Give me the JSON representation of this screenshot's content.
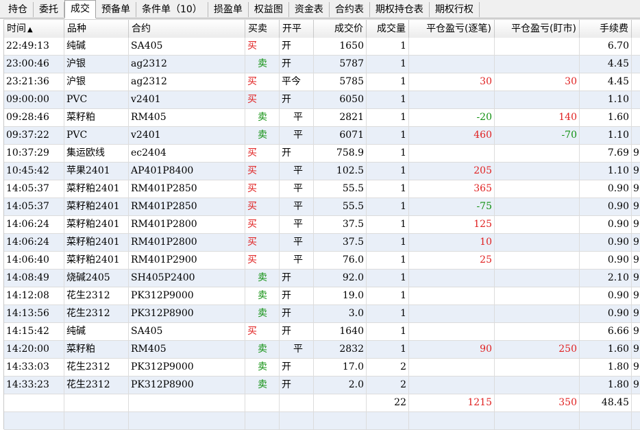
{
  "tabs": [
    {
      "label": "持仓",
      "active": false
    },
    {
      "label": "委托",
      "active": false
    },
    {
      "label": "成交",
      "active": true
    },
    {
      "label": "预备单",
      "active": false
    },
    {
      "label": "条件单（10）",
      "active": false
    },
    {
      "label": "损盈单",
      "active": false
    },
    {
      "label": "权益图",
      "active": false
    },
    {
      "label": "资金表",
      "active": false
    },
    {
      "label": "合约表",
      "active": false
    },
    {
      "label": "期权持仓表",
      "active": false
    },
    {
      "label": "期权行权",
      "active": false
    }
  ],
  "columns": {
    "time": "时间",
    "sort_indicator": "▲",
    "product": "品种",
    "contract": "合约",
    "direction": "买卖",
    "open_close": "开平",
    "price": "成交价",
    "volume": "成交量",
    "pnl_trade": "平仓盈亏(逐笔)",
    "pnl_mark": "平仓盈亏(盯市)",
    "fee": "手续费"
  },
  "rows": [
    {
      "time": "22:49:13",
      "product": "纯碱",
      "contract": "SA405",
      "direction": "买",
      "open_close": "开",
      "price": "1650",
      "volume": "1",
      "pnl_trade": "",
      "pnl_mark": "",
      "fee": "6.70",
      "extra": ""
    },
    {
      "time": "23:00:46",
      "product": "沪银",
      "contract": "ag2312",
      "direction": "卖",
      "open_close": "开",
      "price": "5787",
      "volume": "1",
      "pnl_trade": "",
      "pnl_mark": "",
      "fee": "4.45",
      "extra": ""
    },
    {
      "time": "23:21:36",
      "product": "沪银",
      "contract": "ag2312",
      "direction": "买",
      "open_close": "平今",
      "price": "5785",
      "volume": "1",
      "pnl_trade": "30",
      "pnl_mark": "30",
      "fee": "4.45",
      "extra": ""
    },
    {
      "time": "09:00:00",
      "product": "PVC",
      "contract": "v2401",
      "direction": "买",
      "open_close": "开",
      "price": "6050",
      "volume": "1",
      "pnl_trade": "",
      "pnl_mark": "",
      "fee": "1.10",
      "extra": ""
    },
    {
      "time": "09:28:46",
      "product": "菜籽粕",
      "contract": "RM405",
      "direction": "卖",
      "open_close": "平",
      "price": "2821",
      "volume": "1",
      "pnl_trade": "-20",
      "pnl_mark": "140",
      "fee": "1.60",
      "extra": ""
    },
    {
      "time": "09:37:22",
      "product": "PVC",
      "contract": "v2401",
      "direction": "卖",
      "open_close": "平",
      "price": "6071",
      "volume": "1",
      "pnl_trade": "460",
      "pnl_mark": "-70",
      "fee": "1.10",
      "extra": ""
    },
    {
      "time": "10:37:29",
      "product": "集运欧线",
      "contract": "ec2404",
      "direction": "买",
      "open_close": "开",
      "price": "758.9",
      "volume": "1",
      "pnl_trade": "",
      "pnl_mark": "",
      "fee": "7.69",
      "extra": "9"
    },
    {
      "time": "10:45:42",
      "product": "苹果2401",
      "contract": "AP401P8400",
      "direction": "买",
      "open_close": "平",
      "price": "102.5",
      "volume": "1",
      "pnl_trade": "205",
      "pnl_mark": "",
      "fee": "1.10",
      "extra": "9"
    },
    {
      "time": "14:05:37",
      "product": "菜籽粕2401",
      "contract": "RM401P2850",
      "direction": "买",
      "open_close": "平",
      "price": "55.5",
      "volume": "1",
      "pnl_trade": "365",
      "pnl_mark": "",
      "fee": "0.90",
      "extra": "9"
    },
    {
      "time": "14:05:37",
      "product": "菜籽粕2401",
      "contract": "RM401P2850",
      "direction": "买",
      "open_close": "平",
      "price": "55.5",
      "volume": "1",
      "pnl_trade": "-75",
      "pnl_mark": "",
      "fee": "0.90",
      "extra": "9"
    },
    {
      "time": "14:06:24",
      "product": "菜籽粕2401",
      "contract": "RM401P2800",
      "direction": "买",
      "open_close": "平",
      "price": "37.5",
      "volume": "1",
      "pnl_trade": "125",
      "pnl_mark": "",
      "fee": "0.90",
      "extra": "9"
    },
    {
      "time": "14:06:24",
      "product": "菜籽粕2401",
      "contract": "RM401P2800",
      "direction": "买",
      "open_close": "平",
      "price": "37.5",
      "volume": "1",
      "pnl_trade": "10",
      "pnl_mark": "",
      "fee": "0.90",
      "extra": "9"
    },
    {
      "time": "14:06:40",
      "product": "菜籽粕2401",
      "contract": "RM401P2900",
      "direction": "买",
      "open_close": "平",
      "price": "76.0",
      "volume": "1",
      "pnl_trade": "25",
      "pnl_mark": "",
      "fee": "0.90",
      "extra": "9"
    },
    {
      "time": "14:08:49",
      "product": "烧碱2405",
      "contract": "SH405P2400",
      "direction": "卖",
      "open_close": "开",
      "price": "92.0",
      "volume": "1",
      "pnl_trade": "",
      "pnl_mark": "",
      "fee": "2.10",
      "extra": "9"
    },
    {
      "time": "14:12:08",
      "product": "花生2312",
      "contract": "PK312P9000",
      "direction": "卖",
      "open_close": "开",
      "price": "19.0",
      "volume": "1",
      "pnl_trade": "",
      "pnl_mark": "",
      "fee": "0.90",
      "extra": "9"
    },
    {
      "time": "14:13:56",
      "product": "花生2312",
      "contract": "PK312P8900",
      "direction": "卖",
      "open_close": "开",
      "price": "3.0",
      "volume": "1",
      "pnl_trade": "",
      "pnl_mark": "",
      "fee": "0.90",
      "extra": "9"
    },
    {
      "time": "14:15:42",
      "product": "纯碱",
      "contract": "SA405",
      "direction": "买",
      "open_close": "开",
      "price": "1640",
      "volume": "1",
      "pnl_trade": "",
      "pnl_mark": "",
      "fee": "6.66",
      "extra": "9"
    },
    {
      "time": "14:20:00",
      "product": "菜籽粕",
      "contract": "RM405",
      "direction": "卖",
      "open_close": "平",
      "price": "2832",
      "volume": "1",
      "pnl_trade": "90",
      "pnl_mark": "250",
      "fee": "1.60",
      "extra": "9"
    },
    {
      "time": "14:33:03",
      "product": "花生2312",
      "contract": "PK312P9000",
      "direction": "卖",
      "open_close": "开",
      "price": "17.0",
      "volume": "2",
      "pnl_trade": "",
      "pnl_mark": "",
      "fee": "1.80",
      "extra": "9"
    },
    {
      "time": "14:33:23",
      "product": "花生2312",
      "contract": "PK312P8900",
      "direction": "卖",
      "open_close": "开",
      "price": "2.0",
      "volume": "2",
      "pnl_trade": "",
      "pnl_mark": "",
      "fee": "1.80",
      "extra": "9"
    }
  ],
  "totals": {
    "volume": "22",
    "pnl_trade": "1215",
    "pnl_mark": "350",
    "fee": "48.45"
  },
  "colors": {
    "buy": "#e02020",
    "sell": "#109010",
    "positive": "#e02020",
    "negative": "#109010",
    "row_alt": "#e9eff8"
  }
}
